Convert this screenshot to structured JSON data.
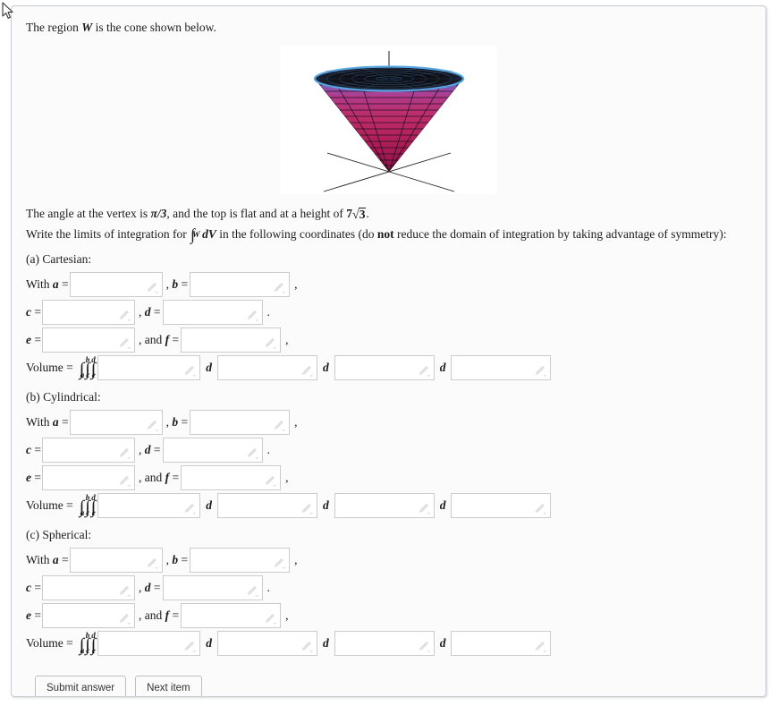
{
  "problem": {
    "intro_prefix": "The region ",
    "intro_var": "W",
    "intro_suffix": " is the cone shown below.",
    "vertex_prefix": "The angle at the vertex is ",
    "vertex_angle": "π/3",
    "vertex_mid": ", and the top is flat and at a height of ",
    "height_coeff": "7",
    "height_radical": "3",
    "vertex_suffix": ".",
    "instruction_prefix": "Write the limits of integration for ",
    "instruction_integral_sub": "W",
    "instruction_integral_body": "dV",
    "instruction_mid": " in the following coordinates (do ",
    "instruction_bold": "not",
    "instruction_suffix": " reduce the domain of integration by taking advantage of symmetry):"
  },
  "figure": {
    "name": "cone-3d-plot",
    "description": "Inverted cone with vertex at origin, flat top disk",
    "colors": {
      "cone_bottom": "#a61a4c",
      "cone_mid": "#c0306e",
      "cone_top_rim": "#5aa8e0",
      "top_disk": "#101018",
      "axis": "#222222",
      "background": "#ffffff"
    }
  },
  "sections": [
    {
      "id": "cartesian",
      "label": "(a) Cartesian:",
      "rows": [
        {
          "lead": "With ",
          "var1": "a",
          "eq": " =",
          "sep": ", ",
          "var2": "b",
          "eq2": " =",
          "tail": ","
        },
        {
          "lead": "",
          "var1": "c",
          "eq": " =",
          "sep": ", ",
          "var2": "d",
          "eq2": " =",
          "tail": "."
        },
        {
          "lead": "",
          "var1": "e",
          "eq": " =",
          "sep": ", and ",
          "var2": "f",
          "eq2": " =",
          "tail": ","
        }
      ],
      "volume": {
        "label": "Volume = ",
        "integrals": [
          {
            "upper": "b",
            "lower": "a"
          },
          {
            "upper": "d",
            "lower": "c"
          },
          {
            "upper": "f",
            "lower": "e"
          }
        ],
        "d_labels": [
          "d",
          "d",
          "d"
        ]
      }
    },
    {
      "id": "cylindrical",
      "label": "(b) Cylindrical:",
      "rows": [
        {
          "lead": "With ",
          "var1": "a",
          "eq": " =",
          "sep": ", ",
          "var2": "b",
          "eq2": " =",
          "tail": ","
        },
        {
          "lead": "",
          "var1": "c",
          "eq": " =",
          "sep": ", ",
          "var2": "d",
          "eq2": " =",
          "tail": "."
        },
        {
          "lead": "",
          "var1": "e",
          "eq": " =",
          "sep": ", and ",
          "var2": "f",
          "eq2": " =",
          "tail": ","
        }
      ],
      "volume": {
        "label": "Volume = ",
        "integrals": [
          {
            "upper": "b",
            "lower": "a"
          },
          {
            "upper": "d",
            "lower": "c"
          },
          {
            "upper": "f",
            "lower": "e"
          }
        ],
        "d_labels": [
          "d",
          "d",
          "d"
        ]
      }
    },
    {
      "id": "spherical",
      "label": "(c) Spherical:",
      "rows": [
        {
          "lead": "With ",
          "var1": "a",
          "eq": " =",
          "sep": ", ",
          "var2": "b",
          "eq2": " =",
          "tail": ","
        },
        {
          "lead": "",
          "var1": "c",
          "eq": " =",
          "sep": ", ",
          "var2": "d",
          "eq2": " =",
          "tail": "."
        },
        {
          "lead": "",
          "var1": "e",
          "eq": " =",
          "sep": ", and ",
          "var2": "f",
          "eq2": " =",
          "tail": ","
        }
      ],
      "volume": {
        "label": "Volume = ",
        "integrals": [
          {
            "upper": "b",
            "lower": "a"
          },
          {
            "upper": "d",
            "lower": "c"
          },
          {
            "upper": "f",
            "lower": "e"
          }
        ],
        "d_labels": [
          "d",
          "d",
          "d"
        ]
      }
    }
  ],
  "inputs": {
    "value": "",
    "placeholder": ""
  },
  "buttons": {
    "submit_label": "Submit answer",
    "next_label": "Next item"
  }
}
